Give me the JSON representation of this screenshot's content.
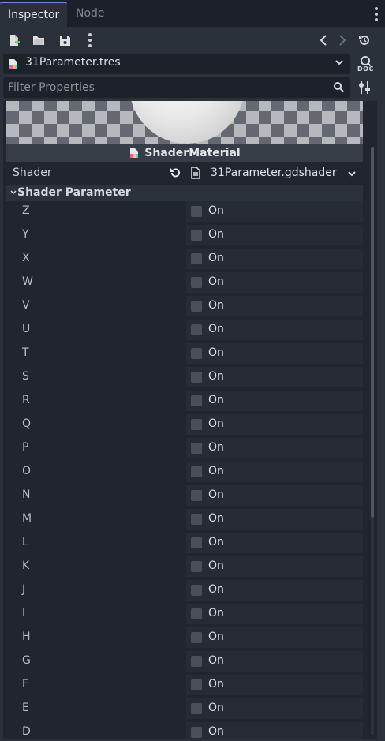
{
  "tabs": [
    {
      "label": "Inspector",
      "active": true
    },
    {
      "label": "Node",
      "active": false
    }
  ],
  "toolbar": {
    "icons": [
      "new-resource-icon",
      "open-folder-icon",
      "save-icon",
      "more-icon",
      "history-back-icon",
      "history-forward-icon",
      "object-history-icon"
    ]
  },
  "resource": {
    "name": "31Parameter.tres",
    "icon": "resource-file-icon"
  },
  "doc_button": {
    "label": "DOC"
  },
  "filter": {
    "placeholder": "Filter Properties"
  },
  "material": {
    "title": "ShaderMaterial"
  },
  "shader_row": {
    "label": "Shader",
    "value": "31Parameter.gdshader"
  },
  "group": {
    "title": "Shader Parameter"
  },
  "parameters": [
    {
      "name": "Z",
      "value": "On"
    },
    {
      "name": "Y",
      "value": "On"
    },
    {
      "name": "X",
      "value": "On"
    },
    {
      "name": "W",
      "value": "On"
    },
    {
      "name": "V",
      "value": "On"
    },
    {
      "name": "U",
      "value": "On"
    },
    {
      "name": "T",
      "value": "On"
    },
    {
      "name": "S",
      "value": "On"
    },
    {
      "name": "R",
      "value": "On"
    },
    {
      "name": "Q",
      "value": "On"
    },
    {
      "name": "P",
      "value": "On"
    },
    {
      "name": "O",
      "value": "On"
    },
    {
      "name": "N",
      "value": "On"
    },
    {
      "name": "M",
      "value": "On"
    },
    {
      "name": "L",
      "value": "On"
    },
    {
      "name": "K",
      "value": "On"
    },
    {
      "name": "J",
      "value": "On"
    },
    {
      "name": "I",
      "value": "On"
    },
    {
      "name": "H",
      "value": "On"
    },
    {
      "name": "G",
      "value": "On"
    },
    {
      "name": "F",
      "value": "On"
    },
    {
      "name": "E",
      "value": "On"
    },
    {
      "name": "D",
      "value": "On"
    }
  ],
  "colors": {
    "accent": "#6a8fd6",
    "background": "#21262e",
    "panel": "#2b313b"
  }
}
